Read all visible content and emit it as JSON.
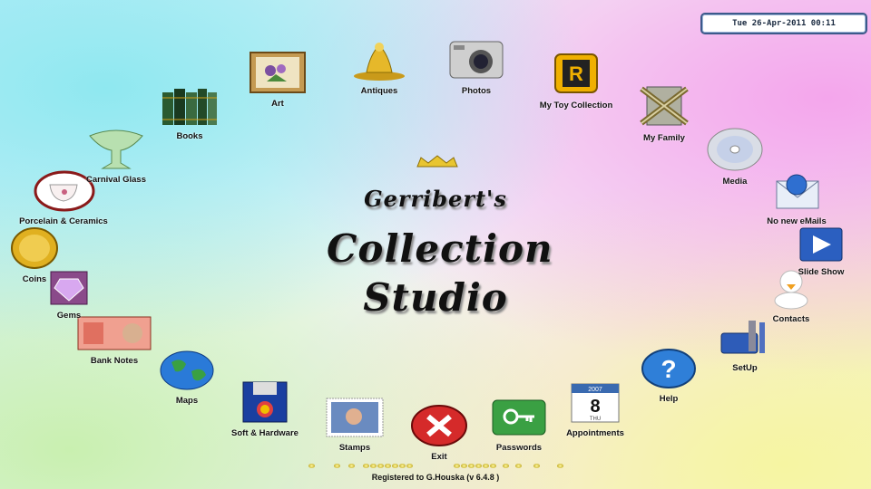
{
  "clock": "Tue  26-Apr-2011  00:11",
  "title": {
    "line1": "Gerribert's",
    "line2": "Collection",
    "line3": "Studio"
  },
  "items": {
    "art": "Art",
    "antiques": "Antiques",
    "photos": "Photos",
    "toys": "My Toy Collection",
    "family": "My Family",
    "media": "Media",
    "emails": "No new eMails",
    "slideshow": "Slide Show",
    "contacts": "Contacts",
    "setup": "SetUp",
    "help": "Help",
    "appointments": "Appointments",
    "passwords": "Passwords",
    "exit": "Exit",
    "stamps": "Stamps",
    "software": "Soft & Hardware",
    "maps": "Maps",
    "banknotes": "Bank Notes",
    "gems": "Gems",
    "coins": "Coins",
    "porcelain": "Porcelain & Ceramics",
    "carnival": "Carnival Glass",
    "books": "Books"
  },
  "appointments_date": {
    "year": "2007",
    "day": "8",
    "weekday": "THU"
  },
  "toy_letter": "R",
  "footer": "Registered to G.Houska  (v 6.4.8 )",
  "colors": {
    "accent_blue": "#3c5a8a",
    "gold": "#d4a017"
  }
}
